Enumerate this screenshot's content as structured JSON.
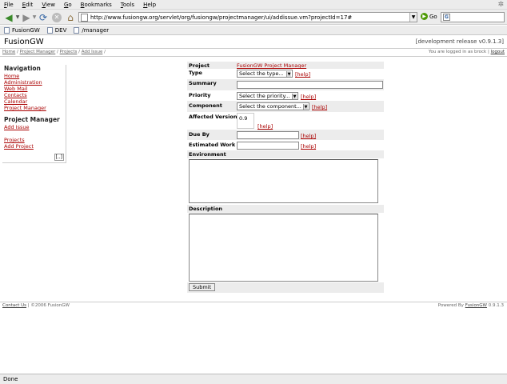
{
  "browser": {
    "menu": [
      {
        "label": "File",
        "u": "F",
        "rest": "ile"
      },
      {
        "label": "Edit",
        "u": "E",
        "rest": "dit"
      },
      {
        "label": "View",
        "u": "V",
        "rest": "iew"
      },
      {
        "label": "Go",
        "u": "G",
        "rest": "o"
      },
      {
        "label": "Bookmarks",
        "u": "B",
        "rest": "ookmarks"
      },
      {
        "label": "Tools",
        "u": "T",
        "rest": "ools"
      },
      {
        "label": "Help",
        "u": "H",
        "rest": "elp"
      }
    ],
    "url": "http://www.fusiongw.org/servlet/org/fusiongw/projectmanager/ui/addissue.vm?projectId=17#",
    "go_label": "Go",
    "search_engine_letter": "G",
    "bookmarks": [
      "FusionGW",
      "DEV",
      "/manager"
    ],
    "status": "Done"
  },
  "header": {
    "site_title": "FusionGW",
    "release": "[development release v0.9.1.3]"
  },
  "breadcrumb": {
    "items": [
      "Home",
      "Project Manager",
      "Projects",
      "Add Issue"
    ],
    "separator": "/",
    "login_text": "You are logged in as brock |",
    "logout": "logout"
  },
  "sidebar": {
    "navigation_title": "Navigation",
    "navigation": [
      "Home",
      "Administration",
      "Web Mail",
      "Contacts",
      "Calendar",
      "Project Manager"
    ],
    "pm_title": "Project Manager",
    "pm_items": [
      "Add Issue"
    ],
    "pm_items2": [
      "Projects",
      "Add Project"
    ],
    "expand": "[..]"
  },
  "form": {
    "project_label": "Project",
    "project_value": "FusionGW Project Manager",
    "type_label": "Type",
    "type_value": "Select the type...",
    "summary_label": "Summary",
    "priority_label": "Priority",
    "priority_value": "Select the priority...",
    "component_label": "Component",
    "component_value": "Select the component...",
    "affected_label": "Affected Version",
    "affected_value": "0.9",
    "dueby_label": "Due By",
    "estwork_label": "Estimated Work",
    "environment_label": "Environment",
    "description_label": "Description",
    "help": "[help]",
    "submit": "Submit"
  },
  "footer": {
    "contact": "Contact Us",
    "copyright": "| ©2006 FusionGW",
    "powered": "Powered By",
    "powered_link": "FusionGW",
    "version": "0.9.1.3"
  }
}
